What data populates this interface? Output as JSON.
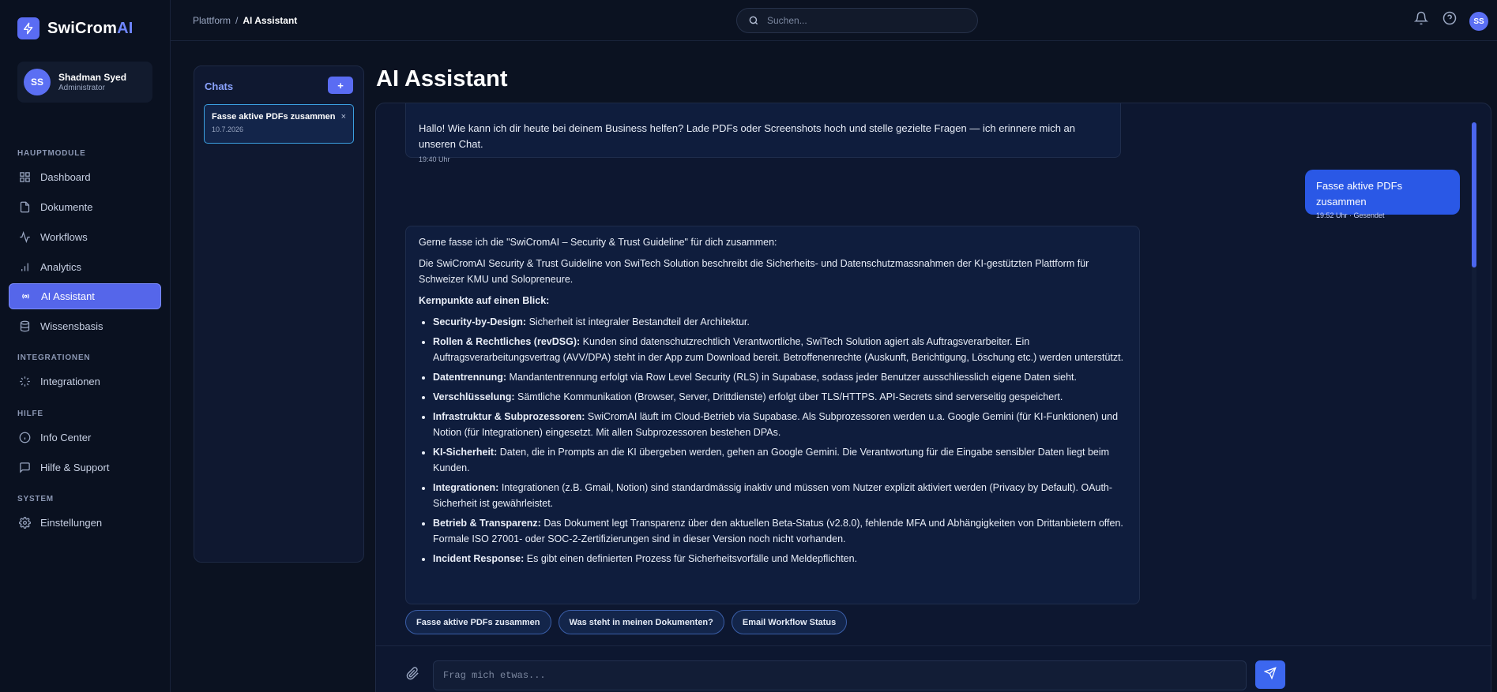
{
  "brand": {
    "name_main": "SwiCrom",
    "name_accent": "AI",
    "logo_icon": "lightning-icon",
    "accent_color": "#6f86ff"
  },
  "user": {
    "initials": "SS",
    "name": "Shadman Syed",
    "role": "Administrator"
  },
  "sidebar": {
    "sections": {
      "main": "HAUPTMODULE",
      "integrations": "INTEGRATIONEN",
      "help": "HILFE",
      "system": "SYSTEM"
    },
    "items": [
      {
        "label": "Dashboard",
        "icon": "grid-icon"
      },
      {
        "label": "Dokumente",
        "icon": "document-icon"
      },
      {
        "label": "Workflows",
        "icon": "activity-icon"
      },
      {
        "label": "Analytics",
        "icon": "bar-chart-icon"
      },
      {
        "label": "AI Assistant",
        "icon": "radio-icon",
        "active": true
      },
      {
        "label": "Wissensbasis",
        "icon": "database-icon"
      },
      {
        "label": "Integrationen",
        "icon": "loader-icon"
      },
      {
        "label": "Info Center",
        "icon": "info-icon"
      },
      {
        "label": "Hilfe & Support",
        "icon": "message-icon"
      },
      {
        "label": "Einstellungen",
        "icon": "gear-icon"
      }
    ]
  },
  "topbar": {
    "breadcrumb": {
      "parent": "Plattform",
      "separator": "/",
      "current": "AI Assistant"
    },
    "search_placeholder": "Suchen...",
    "avatar_initials": "SS"
  },
  "chats": {
    "title": "Chats",
    "new_label": "+",
    "items": [
      {
        "title": "Fasse aktive PDFs zusammen",
        "date": "10.7.2026",
        "close": "×"
      }
    ]
  },
  "page": {
    "title": "AI Assistant"
  },
  "messages": {
    "greeting": {
      "text": "Hallo! Wie kann ich dir heute bei deinem Business helfen? Lade PDFs oder Screenshots hoch und stelle gezielte Fragen — ich erinnere mich an unseren Chat.",
      "time": "19:40 Uhr"
    },
    "user": {
      "text": "Fasse aktive PDFs zusammen",
      "time": "19:52 Uhr · Gesendet"
    },
    "answer": {
      "intro": "Gerne fasse ich die \"SwiCromAI – Security & Trust Guideline\" für dich zusammen:",
      "summary": "Die SwiCromAI Security & Trust Guideline von SwiTech Solution beschreibt die Sicherheits- und Datenschutzmassnahmen der KI-gestützten Plattform für Schweizer KMU und Solopreneure.",
      "heading": "Kernpunkte auf einen Blick:",
      "points": [
        {
          "bold": "Security-by-Design:",
          "text": " Sicherheit ist integraler Bestandteil der Architektur."
        },
        {
          "bold": "Rollen & Rechtliches (revDSG):",
          "text": " Kunden sind datenschutzrechtlich Verantwortliche, SwiTech Solution agiert als Auftragsverarbeiter. Ein Auftragsverarbeitungsvertrag (AVV/DPA) steht in der App zum Download bereit. Betroffenenrechte (Auskunft, Berichtigung, Löschung etc.) werden unterstützt."
        },
        {
          "bold": "Datentrennung:",
          "text": " Mandantentrennung erfolgt via Row Level Security (RLS) in Supabase, sodass jeder Benutzer ausschliesslich eigene Daten sieht."
        },
        {
          "bold": "Verschlüsselung:",
          "text": " Sämtliche Kommunikation (Browser, Server, Drittdienste) erfolgt über TLS/HTTPS. API-Secrets sind serverseitig gespeichert."
        },
        {
          "bold": "Infrastruktur & Subprozessoren:",
          "text": " SwiCromAI läuft im Cloud-Betrieb via Supabase. Als Subprozessoren werden u.a. Google Gemini (für KI-Funktionen) und Notion (für Integrationen) eingesetzt. Mit allen Subprozessoren bestehen DPAs."
        },
        {
          "bold": "KI-Sicherheit:",
          "text": " Daten, die in Prompts an die KI übergeben werden, gehen an Google Gemini. Die Verantwortung für die Eingabe sensibler Daten liegt beim Kunden."
        },
        {
          "bold": "Integrationen:",
          "text": " Integrationen (z.B. Gmail, Notion) sind standardmässig inaktiv und müssen vom Nutzer explizit aktiviert werden (Privacy by Default). OAuth-Sicherheit ist gewährleistet."
        },
        {
          "bold": "Betrieb & Transparenz:",
          "text": " Das Dokument legt Transparenz über den aktuellen Beta-Status (v2.8.0), fehlende MFA und Abhängigkeiten von Drittanbietern offen. Formale ISO 27001- oder SOC-2-Zertifizierungen sind in dieser Version noch nicht vorhanden."
        },
        {
          "bold": "Incident Response:",
          "text": " Es gibt einen definierten Prozess für Sicherheitsvorfälle und Meldepflichten."
        }
      ]
    }
  },
  "suggestions": [
    "Fasse aktive PDFs zusammen",
    "Was steht in meinen Dokumenten?",
    "Email Workflow Status"
  ],
  "composer": {
    "placeholder": "Frag mich etwas..."
  }
}
